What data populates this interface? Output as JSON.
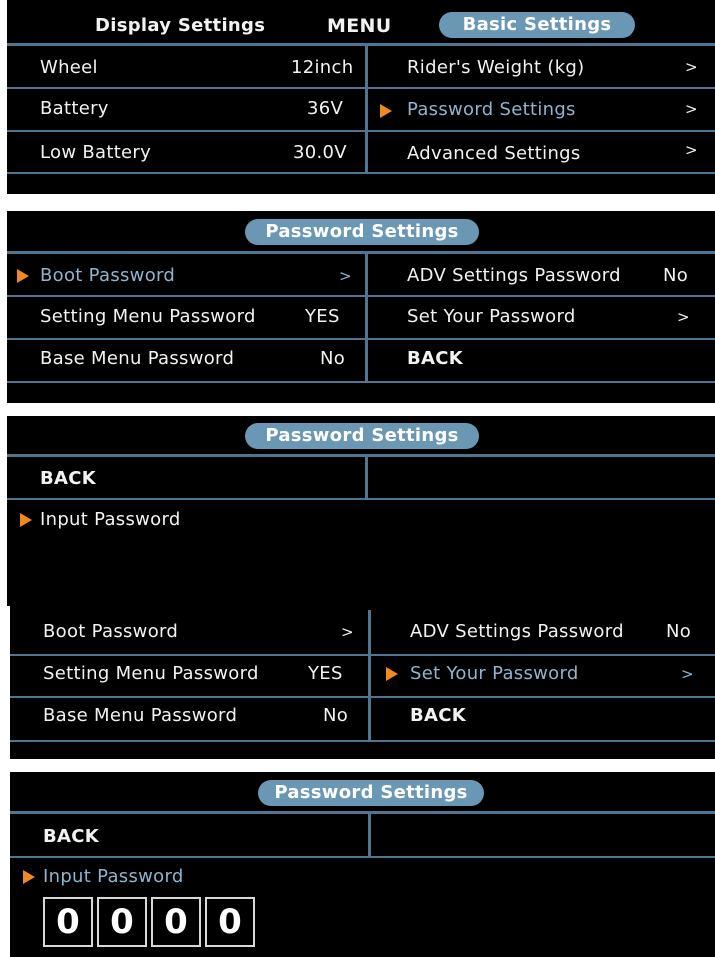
{
  "panel1": {
    "tab_display": "Display Settings",
    "tab_menu": "MENU",
    "tab_basic": "Basic Settings",
    "rows": [
      {
        "label": "Wheel",
        "value": "12inch"
      },
      {
        "label": "Battery",
        "value": "36V"
      },
      {
        "label": "Low Battery",
        "value": "30.0V"
      }
    ],
    "right_rows": [
      {
        "label": "Rider's Weight (kg)",
        "value": ">"
      },
      {
        "label": "Password Settings",
        "value": ">"
      },
      {
        "label": "Advanced Settings",
        "value": ">"
      }
    ]
  },
  "panel2": {
    "title": "Password Settings",
    "rows": [
      {
        "label": "Boot Password",
        "value": ">"
      },
      {
        "label": "Setting Menu Password",
        "value": "YES"
      },
      {
        "label": "Base Menu Password",
        "value": "No"
      }
    ],
    "right_rows": [
      {
        "label": "ADV Settings Password",
        "value": "No"
      },
      {
        "label": "Set Your Password",
        "value": ">"
      },
      {
        "label": "BACK",
        "value": ""
      }
    ]
  },
  "panel3": {
    "title": "Password Settings",
    "back": "BACK",
    "input_password": "Input Password"
  },
  "panel4": {
    "rows": [
      {
        "label": "Boot Password",
        "value": ">"
      },
      {
        "label": "Setting Menu Password",
        "value": "YES"
      },
      {
        "label": "Base Menu Password",
        "value": "No"
      }
    ],
    "right_rows": [
      {
        "label": "ADV Settings Password",
        "value": "No"
      },
      {
        "label": "Set Your Password",
        "value": ">"
      },
      {
        "label": "BACK",
        "value": ""
      }
    ]
  },
  "panel5": {
    "title": "Password Settings",
    "back": "BACK",
    "input_password": "Input Password",
    "digits": [
      "0",
      "0",
      "0",
      "0"
    ]
  },
  "colors": {
    "accent": "#f08a1c",
    "selected_text": "#8fb4cc",
    "pill": "#6a97b3",
    "divider": "#4f7590"
  },
  "icons": [
    "selection-arrow-icon",
    "chevron-right-icon"
  ]
}
